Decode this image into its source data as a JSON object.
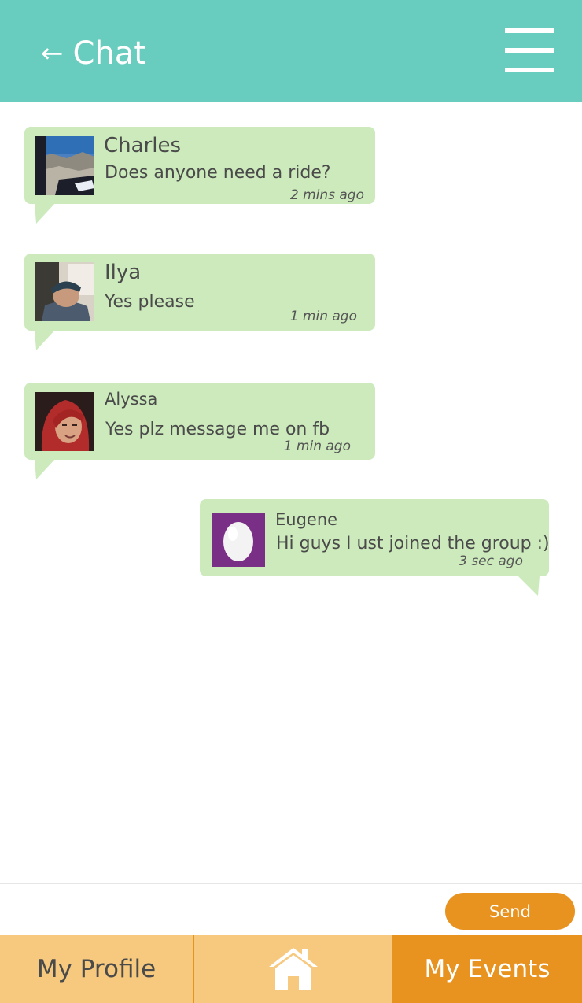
{
  "header": {
    "back_icon": "left-arrow-icon",
    "title": "Chat",
    "menu_icon": "hamburger-menu-icon"
  },
  "messages": [
    {
      "name": "Charles",
      "text": "Does anyone need a ride?",
      "time": "2 mins ago",
      "avatar": "mountain-photo-avatar"
    },
    {
      "name": "Ilya",
      "text": "Yes please",
      "time": "1 min ago",
      "avatar": "man-photo-avatar"
    },
    {
      "name": "Alyssa",
      "text": "Yes plz message me on fb",
      "time": "1 min ago",
      "avatar": "woman-photo-avatar"
    },
    {
      "name": "Eugene",
      "text": "Hi guys I ust joined the group :)",
      "time": "3 sec ago",
      "avatar": "egg-avatar"
    }
  ],
  "composer": {
    "send_label": "Send"
  },
  "bottom_nav": {
    "profile_label": "My Profile",
    "home_icon": "home-icon",
    "events_label": "My Events"
  },
  "colors": {
    "header": "#68cdbf",
    "bubble": "#cceabc",
    "accent": "#e8921f",
    "nav_bg": "#f6c97f",
    "egg_avatar_bg": "#7a2f86"
  }
}
